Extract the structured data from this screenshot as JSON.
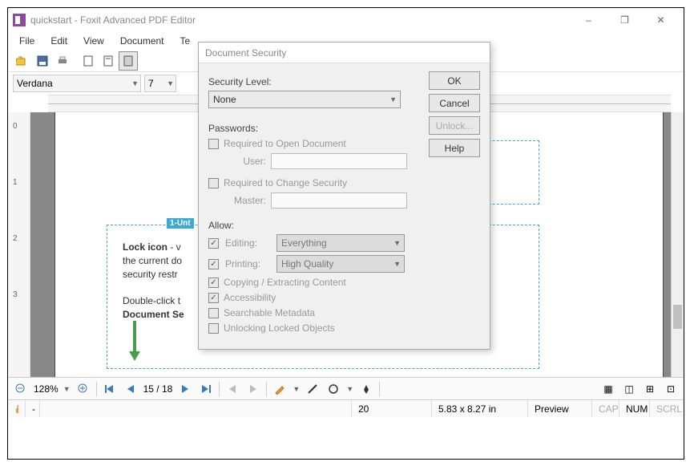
{
  "window": {
    "title": "quickstart - Foxit Advanced PDF Editor",
    "min": "–",
    "max": "❐",
    "close": "✕"
  },
  "menu": [
    "File",
    "Edit",
    "View",
    "Document",
    "Te"
  ],
  "format": {
    "font": "Verdana",
    "size": "7"
  },
  "ruler_nums": [
    "0",
    "1",
    "2",
    "3"
  ],
  "doc": {
    "tag": "1-Unt",
    "p1_b": "Lock icon",
    "p1": " - v",
    "p2": "the current do",
    "p3": "security restr",
    "p4": "Double-click t",
    "p5_b": "Document Se"
  },
  "nav": {
    "zoom": "128%",
    "page": "15 / 18"
  },
  "status": {
    "page_num": "20",
    "dims": "5.83 x 8.27 in",
    "preview": "Preview",
    "cap": "CAP",
    "num": "NUM",
    "scrl": "SCRL"
  },
  "dialog": {
    "title": "Document Security",
    "sec_level_lbl": "Security Level:",
    "sec_level": "None",
    "passwords_lbl": "Passwords:",
    "req_open": "Required to Open Document",
    "user_lbl": "User:",
    "req_change": "Required to Change Security",
    "master_lbl": "Master:",
    "allow_lbl": "Allow:",
    "editing_lbl": "Editing:",
    "editing_val": "Everything",
    "printing_lbl": "Printing:",
    "printing_val": "High Quality",
    "copying": "Copying / Extracting Content",
    "accessibility": "Accessibility",
    "searchable": "Searchable Metadata",
    "unlocking": "Unlocking Locked Objects",
    "ok": "OK",
    "cancel": "Cancel",
    "unlock": "Unlock...",
    "help": "Help"
  }
}
